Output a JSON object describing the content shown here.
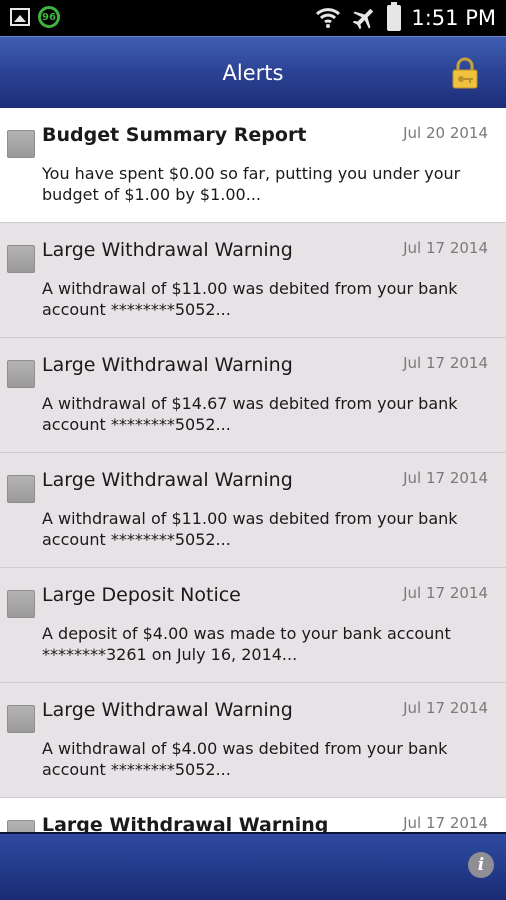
{
  "status_bar": {
    "battery_level": "96",
    "time": "1:51 PM",
    "icons": [
      "gallery-icon",
      "battery-saver-icon",
      "wifi-icon",
      "airplane-mode-icon",
      "battery-icon"
    ]
  },
  "header": {
    "title": "Alerts",
    "lock_icon": "lock-icon"
  },
  "alerts": [
    {
      "title": "Budget Summary Report",
      "date": "Jul 20 2014",
      "body": "You have spent $0.00 so far, putting you under your budget of $1.00 by $1.00...",
      "unread": true
    },
    {
      "title": "Large Withdrawal Warning",
      "date": "Jul 17 2014",
      "body": "A withdrawal of $11.00 was debited from your bank account ********5052...",
      "unread": false
    },
    {
      "title": "Large Withdrawal Warning",
      "date": "Jul 17 2014",
      "body": "A withdrawal of $14.67 was debited from your bank account ********5052...",
      "unread": false
    },
    {
      "title": "Large Withdrawal Warning",
      "date": "Jul 17 2014",
      "body": "A withdrawal of $11.00 was debited from your bank account ********5052...",
      "unread": false
    },
    {
      "title": "Large Deposit Notice",
      "date": "Jul 17 2014",
      "body": "A deposit of $4.00 was made to your bank account ********3261 on July 16, 2014...",
      "unread": false
    },
    {
      "title": "Large Withdrawal Warning",
      "date": "Jul 17 2014",
      "body": "A withdrawal of $4.00 was debited from your bank account ********5052...",
      "unread": false
    },
    {
      "title": "Large Withdrawal Warning",
      "date": "Jul 17 2014",
      "body": "",
      "unread": true
    }
  ],
  "footer": {
    "info_icon": "info-icon",
    "info_glyph": "i"
  },
  "colors": {
    "header_gradient_top": "#3f5fb3",
    "header_gradient_bottom": "#1c2d78",
    "read_row_background": "#e6e2e6",
    "unread_row_background": "#ffffff",
    "battery_saver_green": "#3fb33f"
  }
}
